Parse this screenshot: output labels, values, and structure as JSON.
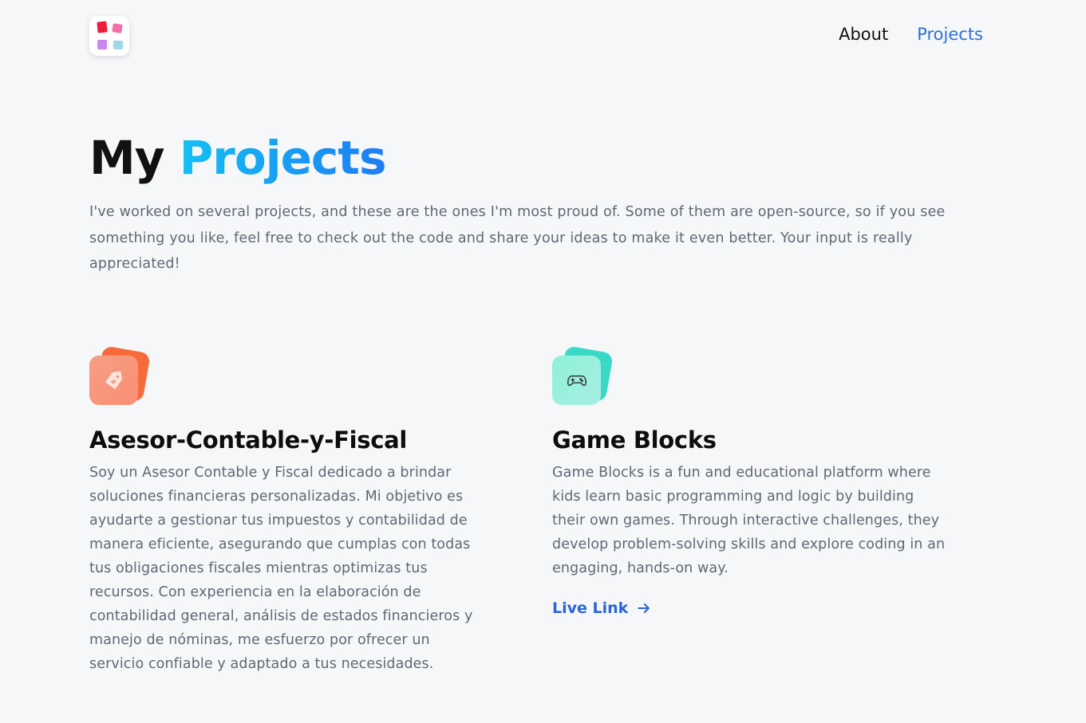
{
  "header": {
    "logo_icon": "app-grid-logo-icon",
    "nav": {
      "about_label": "About",
      "projects_label": "Projects",
      "active": "Projects"
    }
  },
  "hero": {
    "title_plain": "My",
    "title_accent": "Projects",
    "description": "I've worked on several projects, and these are the ones I'm most proud of. Some of them are open-source, so if you see something you like, feel free to check out the code and share your ideas to make it even better. Your input is really appreciated!"
  },
  "projects": [
    {
      "icon": "price-tag-icon",
      "title": "Asesor-Contable-y-Fiscal",
      "description": "Soy un Asesor Contable y Fiscal dedicado a brindar soluciones financieras personalizadas. Mi objetivo es ayudarte a gestionar tus impuestos y contabilidad de manera eficiente, asegurando que cumplas con todas tus obligaciones fiscales mientras optimizas tus recursos. Con experiencia en la elaboración de contabilidad general, análisis de estados financieros y manejo de nóminas, me esfuerzo por ofrecer un servicio confiable y adaptado a tus necesidades."
    },
    {
      "icon": "gamepad-icon",
      "title": "Game Blocks",
      "description": "Game Blocks is a fun and educational platform where kids learn basic programming and logic by building their own games. Through interactive challenges, they develop problem-solving skills and explore coding in an engaging, hands-on way.",
      "link_label": "Live Link",
      "link_icon": "arrow-right-icon"
    }
  ],
  "colors": {
    "background": "#f6f7f9",
    "accent_blue": "#2f6fd8",
    "title_gradient_start": "#13c0f2",
    "title_gradient_end": "#1e7df4",
    "body_text": "#5f6875"
  }
}
